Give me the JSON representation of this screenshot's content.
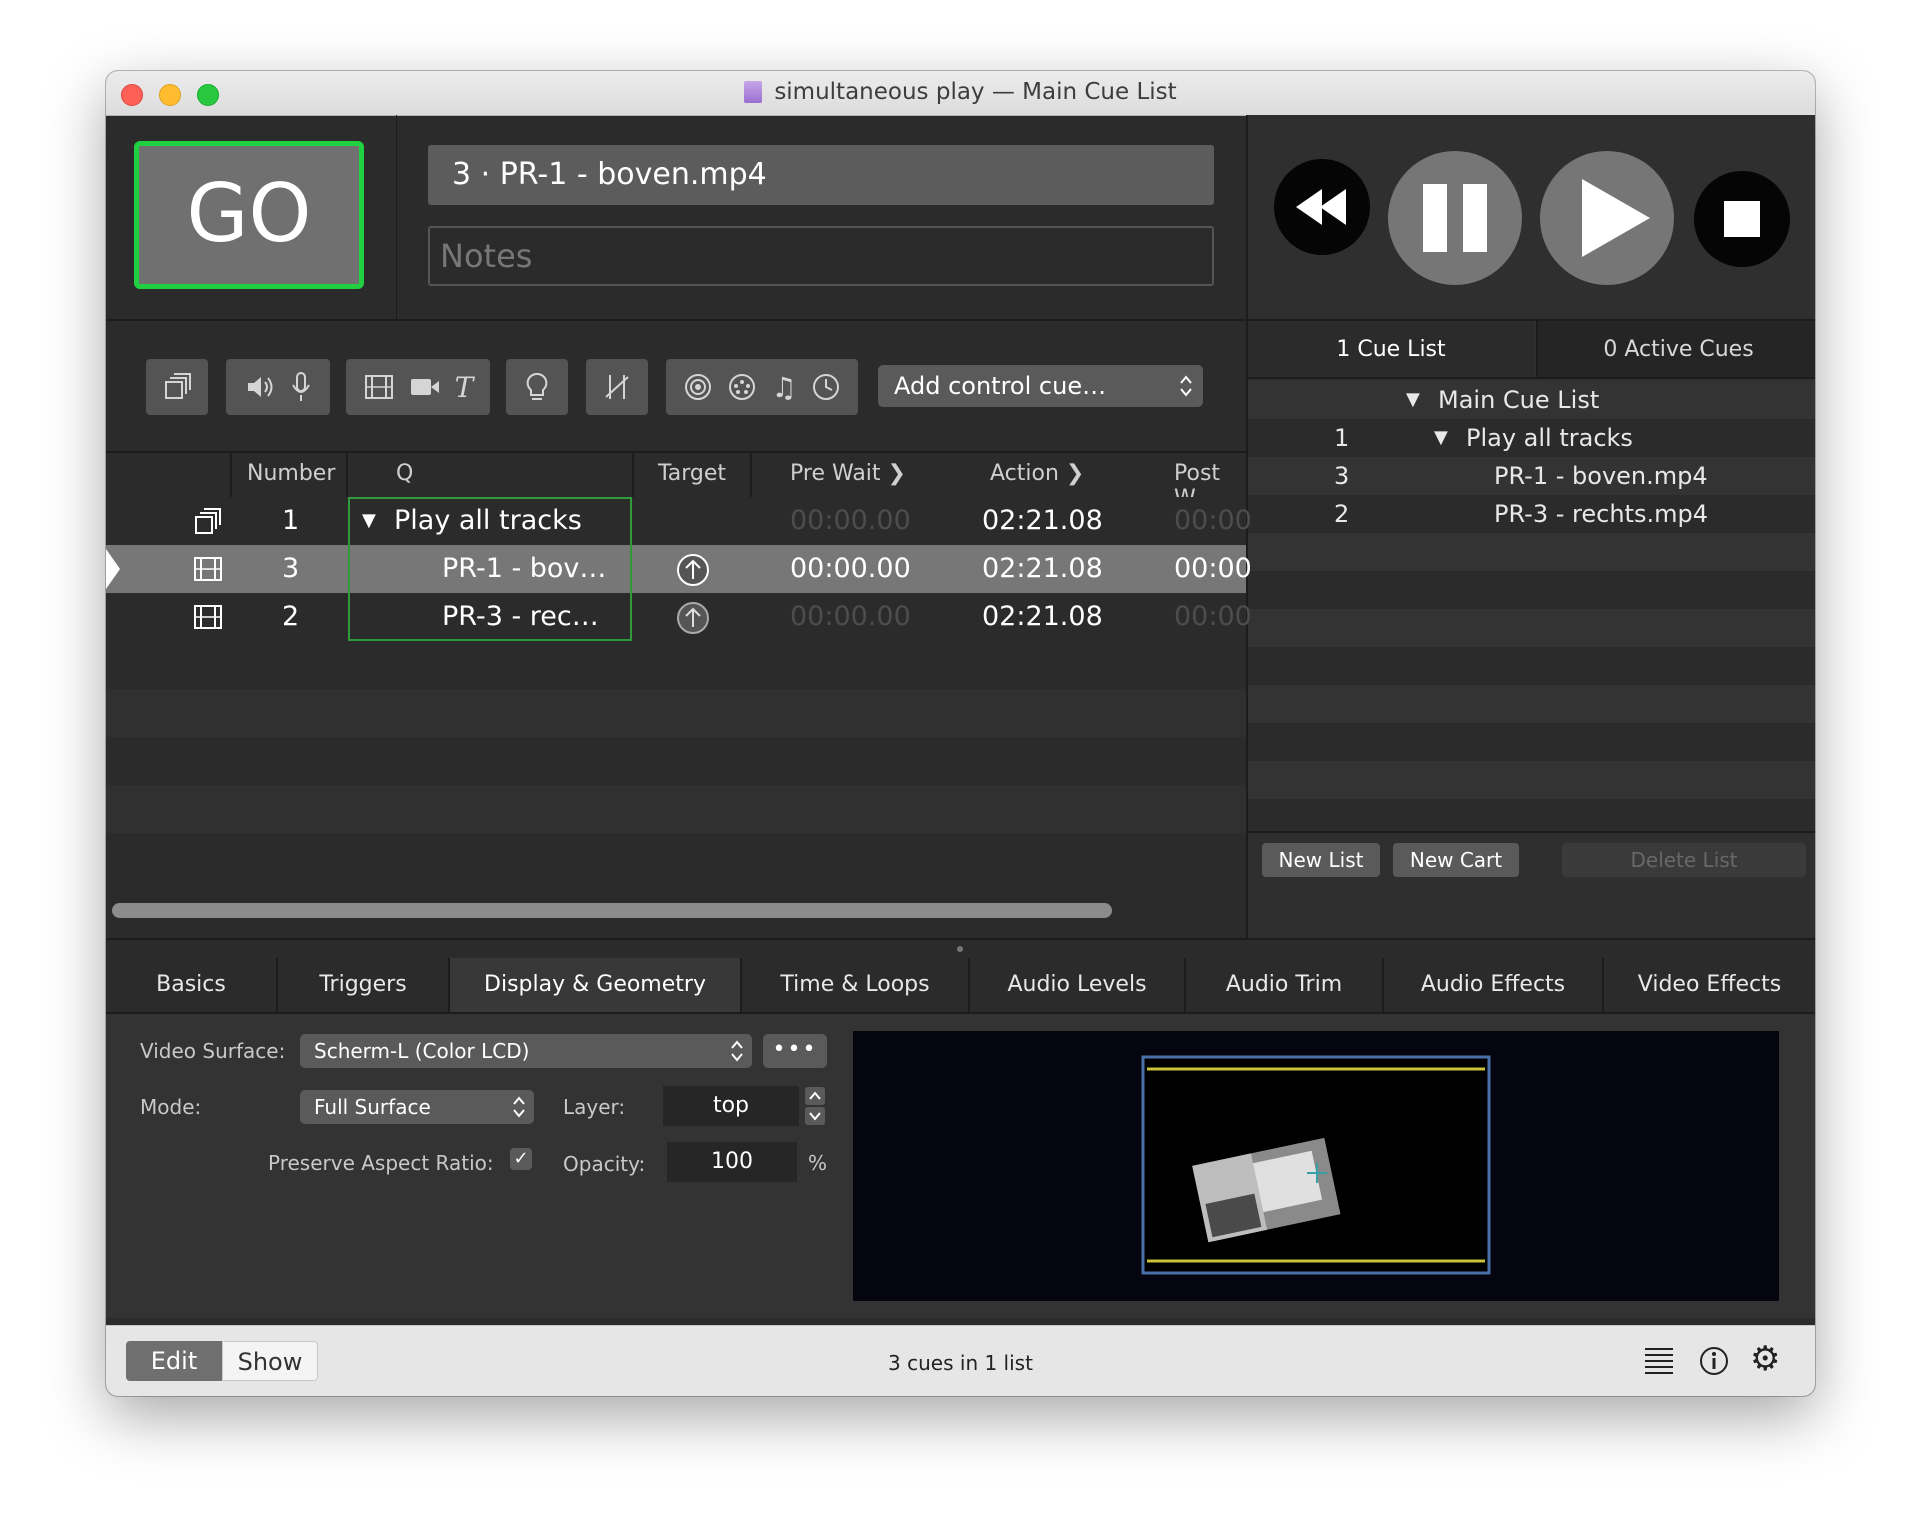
{
  "window": {
    "title": "simultaneous play — Main Cue List"
  },
  "go": {
    "label": "GO"
  },
  "current_cue": {
    "name": "3 · PR-1 - boven.mp4",
    "notes_placeholder": "Notes"
  },
  "toolbar": {
    "add_control_label": "Add control cue…"
  },
  "table": {
    "headers": {
      "number": "Number",
      "q": "Q",
      "target": "Target",
      "pre_wait": "Pre Wait",
      "action": "Action",
      "post_wait": "Post W"
    },
    "rows": [
      {
        "number": "1",
        "q": "Play all tracks",
        "pre_wait": "00:00.00",
        "action": "02:21.08",
        "post_wait": "00:00"
      },
      {
        "number": "3",
        "q": "PR-1 - bov…",
        "pre_wait": "00:00.00",
        "action": "02:21.08",
        "post_wait": "00:00"
      },
      {
        "number": "2",
        "q": "PR-3 - rec…",
        "pre_wait": "00:00.00",
        "action": "02:21.08",
        "post_wait": "00:00"
      }
    ]
  },
  "lists_panel": {
    "tab_cue_list": "1 Cue List",
    "tab_active": "0 Active Cues",
    "items": [
      {
        "number": "",
        "label": "Main Cue List"
      },
      {
        "number": "1",
        "label": "Play all tracks"
      },
      {
        "number": "3",
        "label": "PR-1 - boven.mp4"
      },
      {
        "number": "2",
        "label": "PR-3 - rechts.mp4"
      }
    ],
    "new_list": "New List",
    "new_cart": "New Cart",
    "delete_list": "Delete List"
  },
  "inspector_tabs": [
    "Basics",
    "Triggers",
    "Display & Geometry",
    "Time & Loops",
    "Audio Levels",
    "Audio Trim",
    "Audio Effects",
    "Video Effects"
  ],
  "inspector": {
    "video_surface_label": "Video Surface:",
    "video_surface_value": "Scherm-L (Color LCD)",
    "mode_label": "Mode:",
    "mode_value": "Full Surface",
    "layer_label": "Layer:",
    "layer_value": "top",
    "preserve_label": "Preserve Aspect Ratio:",
    "opacity_label": "Opacity:",
    "opacity_value": "100",
    "opacity_unit": "%"
  },
  "footer": {
    "edit": "Edit",
    "show": "Show",
    "status": "3 cues in 1 list"
  }
}
